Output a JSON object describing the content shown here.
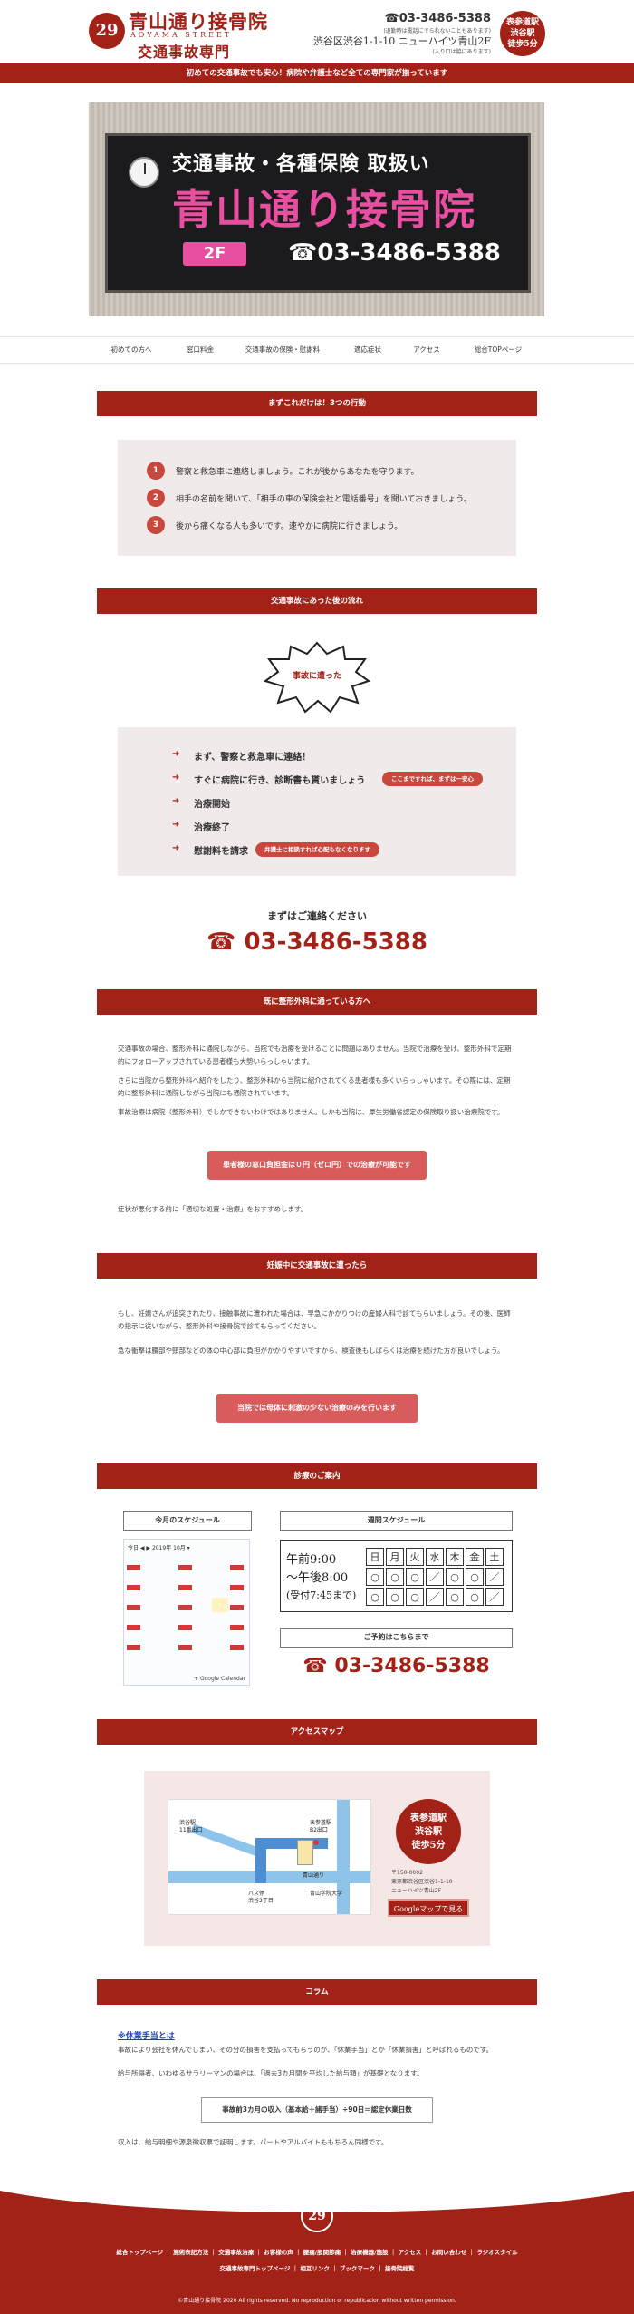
{
  "header": {
    "logo_mark": "29",
    "clinic_name": "青山通り接骨院",
    "street": "AOYAMA STREET",
    "subtitle": "交通事故専門",
    "tel": "☎03-3486-5388",
    "tel_note": "(退勤時は電話にでられないこともあります)",
    "address": "渋谷区渋谷1-1-10 ニューハイツ青山2F",
    "address_note": "(入り口は脇にあります)",
    "badge_lines": [
      "表参道駅",
      "渋谷駅",
      "徒歩5分"
    ]
  },
  "banner": "初めての交通事故でも安心！病院や弁護士など全ての専門家が揃っています",
  "hero": {
    "line1": "交通事故・各種保険 取扱い",
    "line2": "青山通り接骨院",
    "floor": "2F",
    "tel": "☎03-3486-5388"
  },
  "nav": [
    "初めての方へ",
    "窓口料金",
    "交通事故の保険・慰謝料",
    "適応症状",
    "アクセス",
    "総合TOPページ"
  ],
  "first_actions": {
    "title": "まずこれだけは！3つの行動",
    "items": [
      {
        "num": "1",
        "text": "警察と救急車に連絡しましょう。これが後からあなたを守ります。"
      },
      {
        "num": "2",
        "text": "相手の名前を聞いて、「相手の車の保険会社と電話番号」を聞いておきましょう。"
      },
      {
        "num": "3",
        "text": "後から痛くなる人も多いです。速やかに病院に行きましょう。"
      }
    ]
  },
  "flow": {
    "title": "交通事故にあった後の流れ",
    "burst": "事故に遭った",
    "steps": [
      {
        "arrow": "➜",
        "text": "まず、警察と救急車に連絡！"
      },
      {
        "arrow": "➜",
        "text": "すぐに病院に行き、診断書も貰いましょう"
      },
      {
        "arrow": "➜",
        "text": "治療開始"
      },
      {
        "arrow": "➜",
        "text": "治療終了"
      },
      {
        "arrow": "➜",
        "text": "慰謝料を請求"
      }
    ],
    "pill_1": "ここまですれば、まずは一安心",
    "pill_2": "弁護士に相談すれば心配もなくなります"
  },
  "contact": {
    "title": "まずはご連絡ください",
    "tel": "☎ 03-3486-5388"
  },
  "orthopedic": {
    "title": "既に整形外科に通っている方へ",
    "paras": [
      "交通事故の場合、整形外科に通院しながら、当院でも治療を受けることに問題はありません。当院で治療を受け、整形外科で定期的にフォローアップされている患者様も大勢いらっしゃいます。",
      "さらに当院から整形外科へ紹介をしたり、整形外科から当院に紹介されてくる患者様も多くいらっしゃいます。その際には、定期的に整形外科に通院しながら当院にも通院されています。",
      "事故治療は病院（整形外科）でしかできないわけではありません。しかも当院は、厚生労働省認定の保険取り扱い治療院です。"
    ],
    "cta": "患者様の窓口負担金は０円（ゼロ円）での治療が可能です",
    "after": "症状が悪化する前に「適切な処置・治療」をおすすめします。"
  },
  "pregnant": {
    "title": "妊娠中に交通事故に遭ったら",
    "paras": [
      "もし、妊娠さんが追突されたり、接触事故に遭われた場合は、早急にかかりつけの産婦人科で診てもらいましょう。その後、医師の指示に従いながら、整形外科や接骨院で診てもらってください。",
      "急な衝撃は腰部や頸部などの体の中心部に負担がかかりやすいですから、検査後もしばらくは治療を続けた方が良いでしょう。"
    ],
    "cta": "当院では母体に刺激の少ない治療のみを行います"
  },
  "schedule": {
    "title": "診療のご案内",
    "month_title": "今月のスケジュール",
    "week_title": "週間スケジュール",
    "calendar_header": "今日  ◀ ▶  2019年 10月 ▾",
    "calendar_footer": "+ Google Calendar",
    "hours_1": "午前9:00",
    "hours_2": "〜午後8:00",
    "hours_3": "(受付7:45まで)",
    "days": [
      "日",
      "月",
      "火",
      "水",
      "木",
      "金",
      "土"
    ],
    "am": [
      "○",
      "○",
      "○",
      "／",
      "○",
      "○",
      "／"
    ],
    "pm": [
      "○",
      "○",
      "○",
      "／",
      "○",
      "○",
      "／"
    ],
    "reserve_title": "ご予約はこちらまで",
    "tel": "☎ 03-3486-5388"
  },
  "access": {
    "title": "アクセスマップ",
    "badge_lines": [
      "表参道駅",
      "渋谷駅",
      "徒歩5分"
    ],
    "addr_lines": [
      "〒150-0002",
      "東京都渋谷区渋谷1-1-10",
      "ニューハイツ青山2F"
    ],
    "map_button": "Googleマップで見る",
    "map_labels": [
      "渋谷駅",
      "11番出口",
      "表参道駅",
      "B2出口",
      "バス停",
      "渋谷2丁目",
      "青山学院大学",
      "青山通り"
    ]
  },
  "column": {
    "title": "コラム",
    "link": "※休業手当とは",
    "paras": [
      "事故により会社を休んでしまい、その分の損害を支払ってもらうのが、「休業手当」とか「休業損害」と呼ばれるものです。",
      "給与所得者、いわゆるサラリーマンの場合は、「過去3カ月間を平均した給与額」が基礎となります。"
    ],
    "formula": "事故前3カ月の収入（基本給＋諸手当）÷90日＝認定休業日数",
    "after": "収入は、給与明細や源泉徴収票で証明します。パートやアルバイトももちろん同様です。"
  },
  "footer": {
    "logo_mark": "29",
    "links_row1": "総合トップページ ｜ 施術表記方法 ｜ 交通事故治療 ｜ お客様の声 ｜ 腰痛/股関節痛 ｜ 治療機器/施設 ｜ アクセス ｜ お問い合わせ ｜ ラジオスタイル",
    "links_row2": "交通事故専門トップページ ｜ 相互リンク ｜ ブックマーク ｜ 接骨院総覧",
    "copyright": "©青山通り接骨院 2020 All rights reserved. No reproduction or republication without written permission."
  },
  "colors": {
    "brand_red": "#a32218",
    "accent_red": "#d85c5c",
    "panel_pink": "#f1eaea",
    "pink_text": "#e84fa0"
  }
}
